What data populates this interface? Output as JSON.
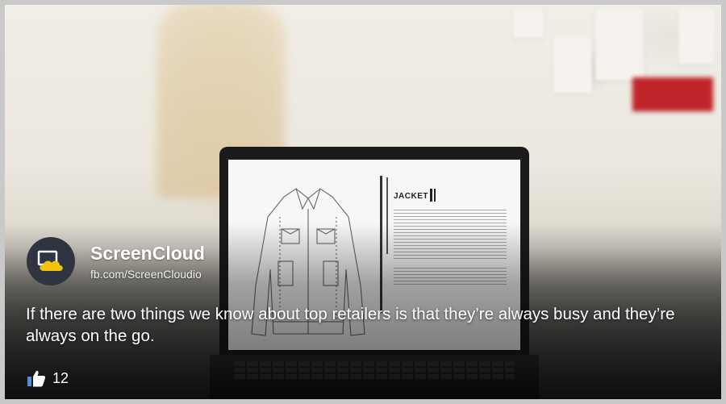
{
  "post": {
    "brand_name": "ScreenCloud",
    "handle": "fb.com/ScreenCloudio",
    "text": "If there are two things we know about top retailers is that they’re always busy and they’re always on the go.",
    "like_count": "12"
  },
  "laptop_screen": {
    "title": "JACKET"
  },
  "icons": {
    "avatar": "screencloud-logo-icon",
    "like": "thumbs-up-icon"
  },
  "colors": {
    "logo_yellow": "#f2c20f",
    "avatar_bg": "#2e3540",
    "frame": "#c9c9c9"
  }
}
